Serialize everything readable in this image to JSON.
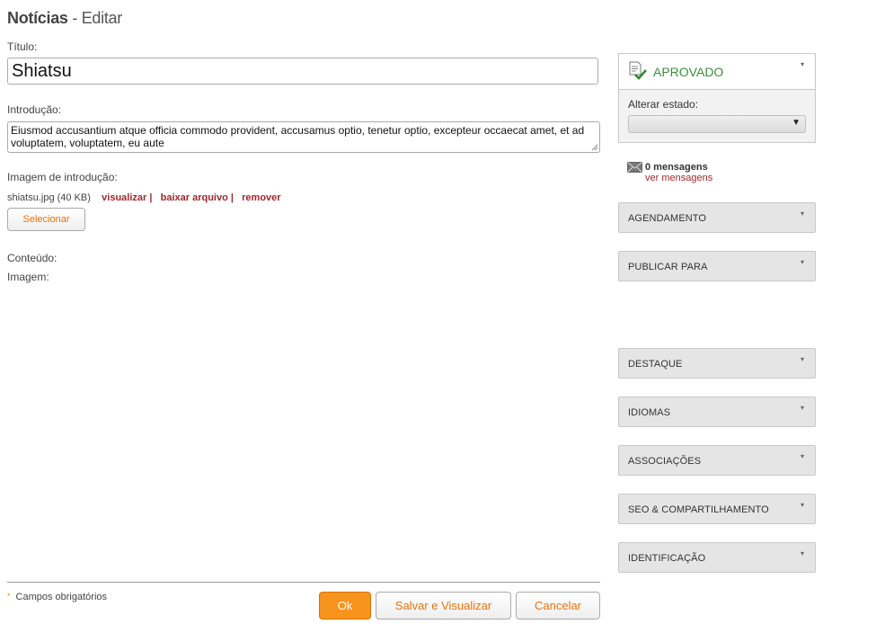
{
  "header": {
    "title_bold": "Notícias",
    "title_rest": " - Editar"
  },
  "form": {
    "title_label": "Título:",
    "title_value": "Shiatsu",
    "intro_label": "Introdução:",
    "intro_value": "Eiusmod accusantium atque officia commodo provident, accusamus optio, tenetur optio, excepteur occaecat amet, et ad voluptatem, voluptatem, eu aute",
    "intro_image_label": "Imagem de introdução:",
    "file_info": "shiatsu.jpg (40 KB)",
    "view_link": "visualizar |",
    "download_link": "baixar arquivo |",
    "remove_link": "remover",
    "select_button": "Selecionar",
    "content_label": "Conteúdo:",
    "image_label": "Imagem:",
    "required_note": "Campos obrigatórios",
    "required_marker": "*"
  },
  "actions": {
    "ok": "Ok",
    "save_view": "Salvar e Visualizar",
    "cancel": "Cancelar"
  },
  "status": {
    "state": "APROVADO",
    "change_label": "Alterar estado:",
    "select_value": "",
    "caret": "▾"
  },
  "messages": {
    "count": "0 mensagens",
    "link": "ver mensagens"
  },
  "panels": [
    {
      "label": "AGENDAMENTO"
    },
    {
      "label": "PUBLICAR PARA"
    },
    {
      "label": "DESTAQUE"
    },
    {
      "label": "IDIOMAS"
    },
    {
      "label": "ASSOCIAÇÕES"
    },
    {
      "label": "SEO & COMPARTILHAMENTO"
    },
    {
      "label": "IDENTIFICAÇÃO"
    }
  ],
  "colors": {
    "accent": "#f7941d",
    "link": "#a0282d",
    "approved": "#3b8f3b"
  }
}
